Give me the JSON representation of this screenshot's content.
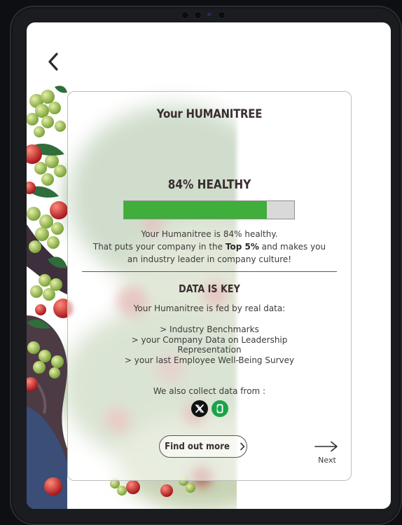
{
  "card": {
    "title": "Your HUMANITREE",
    "health_heading": "84% HEALTHY",
    "health_percent": 84,
    "health_line1": "Your Humanitree is 84% healthy.",
    "health_line2_pre": "That puts your company in the ",
    "health_line2_bold": "Top 5%",
    "health_line2_post": " and makes you",
    "health_line3": "an industry leader in company culture!",
    "data_heading": "DATA IS KEY",
    "data_intro": "Your Humanitree is fed by real data:",
    "sources": [
      "> Industry Benchmarks",
      "> your Company Data on Leadership Representation",
      "> your last Employee Well-Being Survey"
    ],
    "collect_text": "We also collect data from :",
    "find_out_label": "Find out more",
    "next_label": "Next"
  },
  "icons": {
    "back": "chevron-left-icon",
    "x": "x-logo-icon",
    "glassdoor": "glassdoor-logo-icon",
    "find_out": "chevron-right-icon",
    "next": "arrow-right-icon"
  },
  "colors": {
    "progress_fill": "#3fae3a",
    "progress_track": "#d9d9d9",
    "x_brand": "#111111",
    "glassdoor_brand": "#1aa34a",
    "text_dark": "#3a2e30"
  }
}
